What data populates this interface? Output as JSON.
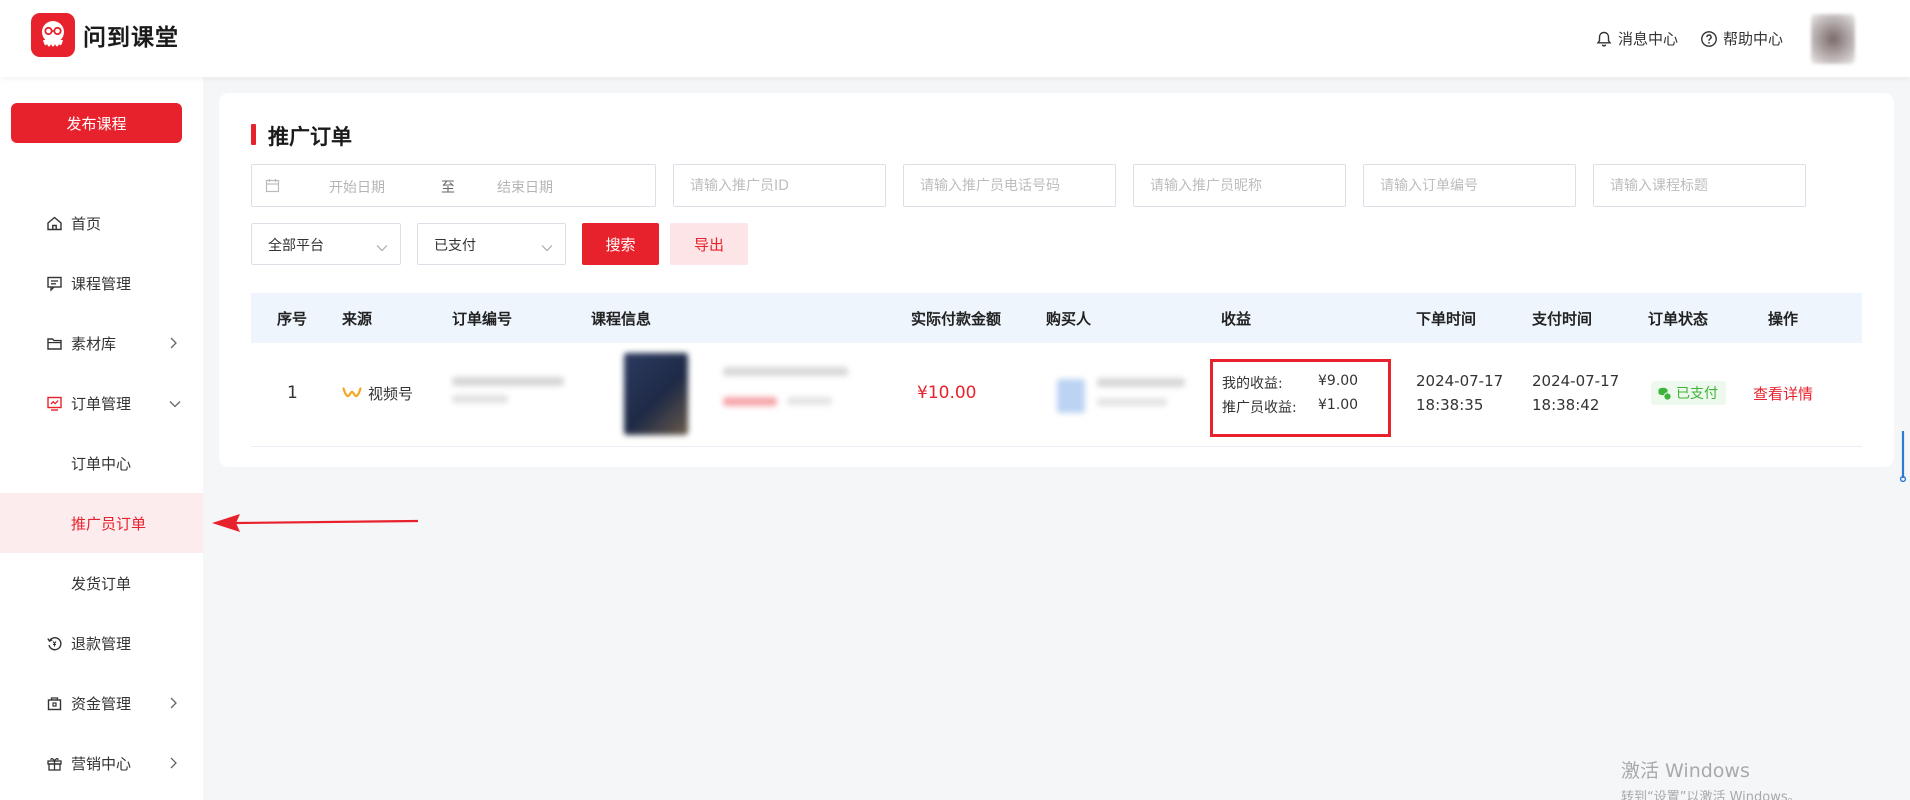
{
  "brand": {
    "name": "问到课堂",
    "accent": "#e8222c"
  },
  "header": {
    "messages_label": "消息中心",
    "help_label": "帮助中心"
  },
  "sidebar": {
    "publish_label": "发布课程",
    "items": [
      {
        "label": "首页",
        "icon": "home-icon"
      },
      {
        "label": "课程管理",
        "icon": "course-icon"
      },
      {
        "label": "素材库",
        "icon": "folder-icon"
      },
      {
        "label": "订单管理",
        "icon": "order-icon"
      },
      {
        "label": "订单中心"
      },
      {
        "label": "推广员订单"
      },
      {
        "label": "发货订单"
      },
      {
        "label": "退款管理",
        "icon": "refund-icon"
      },
      {
        "label": "资金管理",
        "icon": "wallet-icon"
      },
      {
        "label": "营销中心",
        "icon": "gift-icon"
      }
    ]
  },
  "page": {
    "title": "推广订单",
    "filters": {
      "start_date": "开始日期",
      "range_sep": "至",
      "end_date": "结束日期",
      "promoter_id": "请输入推广员ID",
      "promoter_phone": "请输入推广员电话号码",
      "promoter_nickname": "请输入推广员昵称",
      "order_no": "请输入订单编号",
      "course_title": "请输入课程标题",
      "platform": "全部平台",
      "pay_status": "已支付",
      "search_label": "搜索",
      "export_label": "导出"
    },
    "table": {
      "columns": [
        "序号",
        "来源",
        "订单编号",
        "课程信息",
        "实际付款金额",
        "购买人",
        "收益",
        "下单时间",
        "支付时间",
        "订单状态",
        "操作"
      ],
      "rows": [
        {
          "index": "1",
          "source": "视频号",
          "amount": "¥10.00",
          "my_income_label": "我的收益:",
          "my_income": "¥9.00",
          "promoter_income_label": "推广员收益:",
          "promoter_income": "¥1.00",
          "order_date": "2024-07-17",
          "order_time": "18:38:35",
          "pay_date": "2024-07-17",
          "pay_time": "18:38:42",
          "status": "已支付",
          "action": "查看详情"
        }
      ]
    }
  },
  "watermark": {
    "line1": "激活 Windows",
    "line2": "转到“设置”以激活 Windows。"
  }
}
